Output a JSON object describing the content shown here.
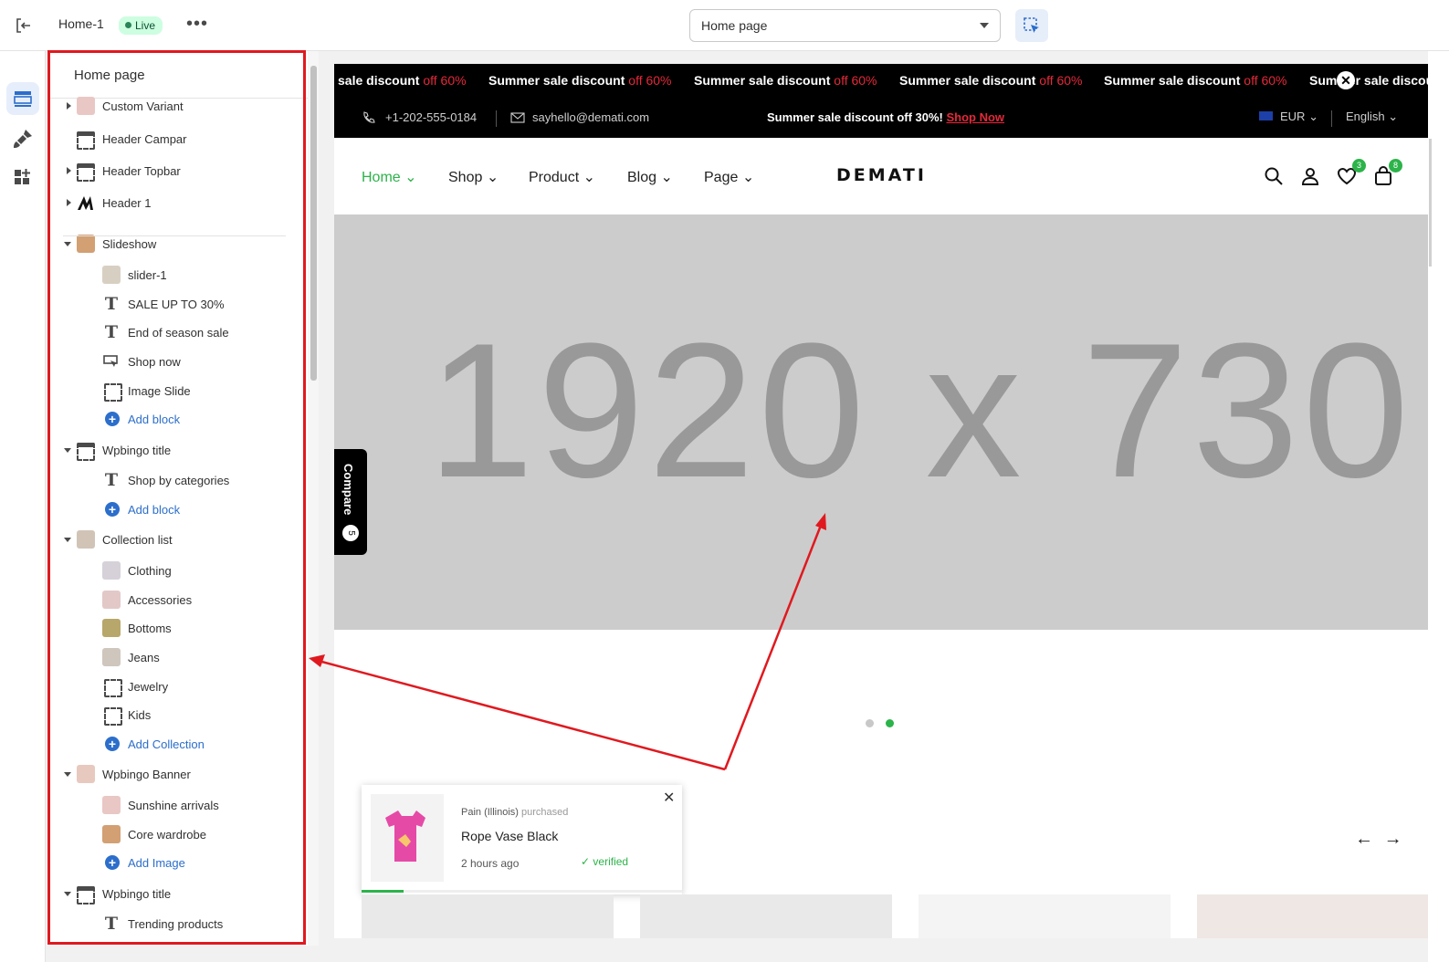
{
  "topbar": {
    "theme_name": "Home-1",
    "live_badge": "Live",
    "more": "•••",
    "page_select": "Home page"
  },
  "panel": {
    "title": "Home page",
    "items": [
      {
        "label": "Custom Variant",
        "kind": "parent",
        "state": "collapsed",
        "icon": "image-thumb"
      },
      {
        "label": "Header Campar",
        "kind": "parent",
        "state": "none",
        "icon": "section-icon"
      },
      {
        "label": "Header Topbar",
        "kind": "parent",
        "state": "collapsed",
        "icon": "section-icon"
      },
      {
        "label": "Header 1",
        "kind": "parent",
        "state": "collapsed",
        "icon": "logo-thumb"
      },
      {
        "label": "Slideshow",
        "kind": "parent",
        "state": "expanded",
        "icon": "image-thumb"
      },
      {
        "label": "slider-1",
        "kind": "child",
        "icon": "image-thumb"
      },
      {
        "label": "SALE UP TO 30%",
        "kind": "child",
        "icon": "text-icon"
      },
      {
        "label": "End of season sale",
        "kind": "child",
        "icon": "text-icon"
      },
      {
        "label": "Shop now",
        "kind": "child",
        "icon": "button-icon"
      },
      {
        "label": "Image Slide",
        "kind": "child",
        "icon": "frame-icon"
      },
      {
        "label": "Add block",
        "kind": "add",
        "icon": "plus-icon"
      },
      {
        "label": "Wpbingo title",
        "kind": "parent",
        "state": "expanded",
        "icon": "section-icon"
      },
      {
        "label": "Shop by categories",
        "kind": "child",
        "icon": "text-icon"
      },
      {
        "label": "Add block",
        "kind": "add",
        "icon": "plus-icon"
      },
      {
        "label": "Collection list",
        "kind": "parent",
        "state": "expanded",
        "icon": "image-thumb"
      },
      {
        "label": "Clothing",
        "kind": "child",
        "icon": "image-thumb"
      },
      {
        "label": "Accessories",
        "kind": "child",
        "icon": "image-thumb"
      },
      {
        "label": "Bottoms",
        "kind": "child",
        "icon": "image-thumb"
      },
      {
        "label": "Jeans",
        "kind": "child",
        "icon": "image-thumb"
      },
      {
        "label": "Jewelry",
        "kind": "child",
        "icon": "frame-icon"
      },
      {
        "label": "Kids",
        "kind": "child",
        "icon": "frame-icon"
      },
      {
        "label": "Add Collection",
        "kind": "add",
        "icon": "plus-icon"
      },
      {
        "label": "Wpbingo Banner",
        "kind": "parent",
        "state": "expanded",
        "icon": "image-thumb"
      },
      {
        "label": "Sunshine arrivals",
        "kind": "child",
        "icon": "image-thumb"
      },
      {
        "label": "Core wardrobe",
        "kind": "child",
        "icon": "image-thumb"
      },
      {
        "label": "Add Image",
        "kind": "add",
        "icon": "plus-icon"
      },
      {
        "label": "Wpbingo title",
        "kind": "parent",
        "state": "expanded",
        "icon": "section-icon"
      },
      {
        "label": "Trending products",
        "kind": "child",
        "icon": "text-icon"
      }
    ]
  },
  "preview": {
    "ticker": [
      {
        "text": "sale discount ",
        "off": "off 60%"
      },
      {
        "text": "Summer sale discount ",
        "off": "off 60%"
      },
      {
        "text": "Summer sale discount ",
        "off": "off 60%"
      },
      {
        "text": "Summer sale discount ",
        "off": "off 60%"
      },
      {
        "text": "Summer sale discount ",
        "off": "off 60%"
      },
      {
        "text": "Summer sale discou",
        "off": ""
      }
    ],
    "phone": "+1-202-555-0184",
    "email": "sayhello@demati.com",
    "promo": "Summer sale discount off 30%! ",
    "promo_link": "Shop Now",
    "currency": "EUR",
    "language": "English",
    "nav": [
      "Home",
      "Shop",
      "Product",
      "Blog",
      "Page"
    ],
    "logo": "DEMATI",
    "wishlist_count": "3",
    "cart_count": "8",
    "hero_placeholder": "1920 x 730",
    "compare_label": "Compare",
    "compare_count": "5",
    "popup": {
      "buyer": "Pain (Illinois)",
      "action": " purchased",
      "product": "Rope Vase Black",
      "time": "2 hours ago",
      "verified": "verified",
      "progress": 0.13
    },
    "slide_dots": 2,
    "active_dot": 1
  },
  "colors": {
    "accent": "#2cb34a",
    "sale": "#e5283a",
    "annotation": "#e0191f",
    "link": "#2c6ecb"
  }
}
